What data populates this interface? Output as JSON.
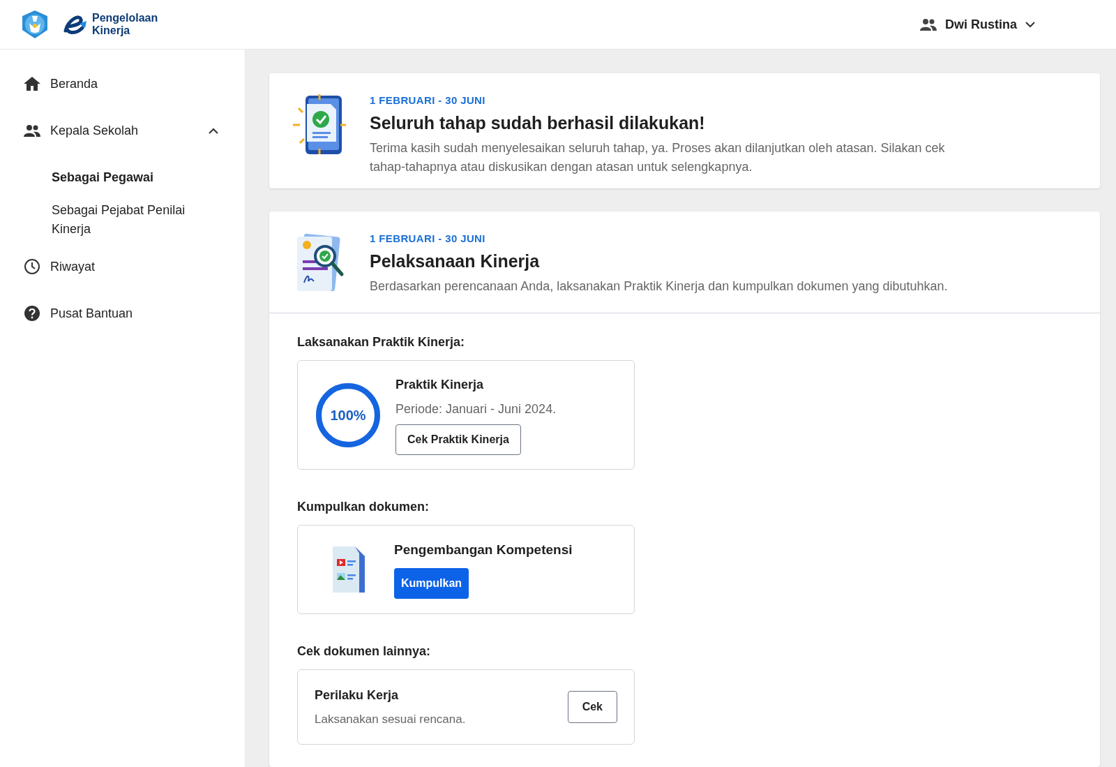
{
  "header": {
    "brand": [
      "Pengelolaan",
      "Kinerja"
    ],
    "user": "Dwi Rustina"
  },
  "sidebar": {
    "items": [
      {
        "label": "Beranda",
        "selected": false
      },
      {
        "label": "Kepala Sekolah",
        "selected": false,
        "expanded": true,
        "children": [
          {
            "label": "Sebagai Pegawai",
            "selected": true
          },
          {
            "label": "Sebagai Pejabat Penilai Kinerja",
            "selected": false
          }
        ]
      },
      {
        "label": "Riwayat",
        "selected": false
      },
      {
        "label": "Pusat Bantuan",
        "selected": false
      }
    ]
  },
  "banner": {
    "date": "1 FEBRUARI - 30 JUNI",
    "title": "Seluruh tahap sudah berhasil dilakukan!",
    "text": "Terima kasih sudah menyelesaikan seluruh tahap, ya. Proses akan dilanjutkan oleh atasan. Silakan cek tahap-tahapnya atau diskusikan dengan atasan untuk selengkapnya."
  },
  "stage": {
    "date": "1 FEBRUARI - 30 JUNI",
    "title": "Pelaksanaan Kinerja",
    "text": "Berdasarkan perencanaan Anda, laksanakan Praktik Kinerja dan kumpulkan dokumen yang dibutuhkan.",
    "sections": [
      {
        "heading": "Laksanakan Praktik Kinerja:",
        "kind": "progress",
        "title": "Praktik Kinerja",
        "subtitle": "Periode: Januari - Juni 2024.",
        "level": 1,
        "reading": "100%",
        "button": "Cek Praktik Kinerja"
      },
      {
        "heading": "Kumpulkan dokumen:",
        "kind": "upload",
        "title": "Pengembangan Kompetensi",
        "button": "Kumpulkan"
      },
      {
        "heading": "Cek dokumen lainnya:",
        "kind": "check",
        "title": "Perilaku Kerja",
        "subtitle": "Laksanakan sesuai rencana.",
        "button": "Cek"
      }
    ]
  }
}
